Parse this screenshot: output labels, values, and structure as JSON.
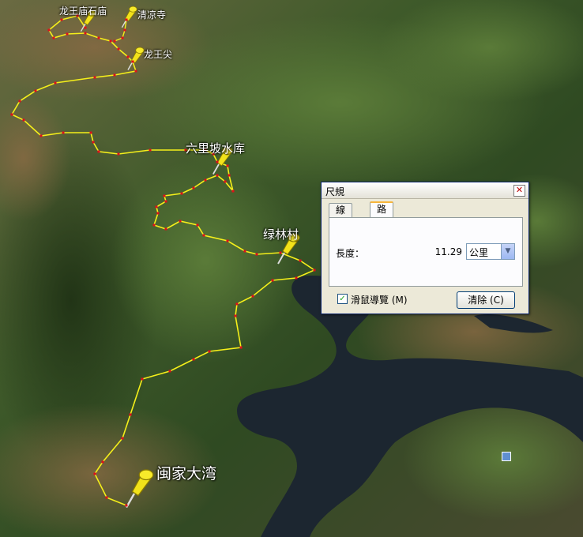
{
  "map": {
    "placemarks": [
      {
        "id": "longwang-miao",
        "label": "龙王庙石庙",
        "size": "sm"
      },
      {
        "id": "qingliang-si",
        "label": "清凉寺",
        "size": "sm"
      },
      {
        "id": "longwang-jian",
        "label": "龙王尖",
        "size": "sm"
      },
      {
        "id": "liulipo",
        "label": "六里坡水库",
        "size": "md"
      },
      {
        "id": "lulin-cun",
        "label": "绿林村",
        "size": "md"
      },
      {
        "id": "yanjia-dawan",
        "label": "闽家大湾",
        "size": "lg"
      }
    ],
    "track_color": "#f5ef1a",
    "vertex_color": "#e0101a",
    "water_color": "#1c2630"
  },
  "ruler": {
    "title": "尺規",
    "close_icon": "close-icon",
    "tabs": [
      "線條",
      "路徑"
    ],
    "active_tab": "路徑",
    "length_label": "長度：",
    "length_value": "11.29",
    "unit": "公里",
    "mouse_nav_label": "滑鼠導覽 (M)",
    "mouse_nav_checked": true,
    "clear_label": "清除 (C)"
  }
}
